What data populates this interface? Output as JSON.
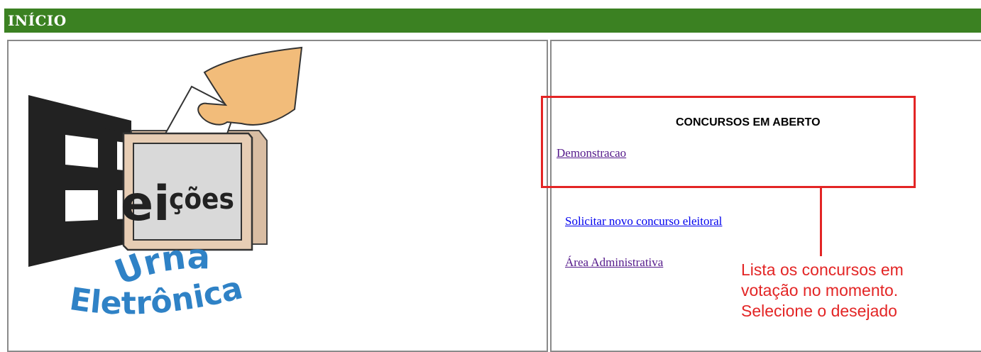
{
  "header": {
    "title": "INÍCIO"
  },
  "logo": {
    "word_el": "El",
    "word_ei": "ei",
    "word_coes": "ções",
    "word_urna": "Urna",
    "word_eletronica": "Eletrônica"
  },
  "concursos": {
    "title": "CONCURSOS EM ABERTO",
    "items": [
      "Demonstracao"
    ]
  },
  "links": {
    "solicitar": "Solicitar novo concurso eleitoral",
    "admin": "Área Administrativa"
  },
  "annotation": {
    "lines": [
      "Lista os concursos em",
      "votação no momento.",
      "Selecione o desejado"
    ],
    "color": "#e32525"
  },
  "colors": {
    "header_bg": "#3b8122",
    "link_visited": "#551a8b",
    "link": "#0000ee"
  }
}
